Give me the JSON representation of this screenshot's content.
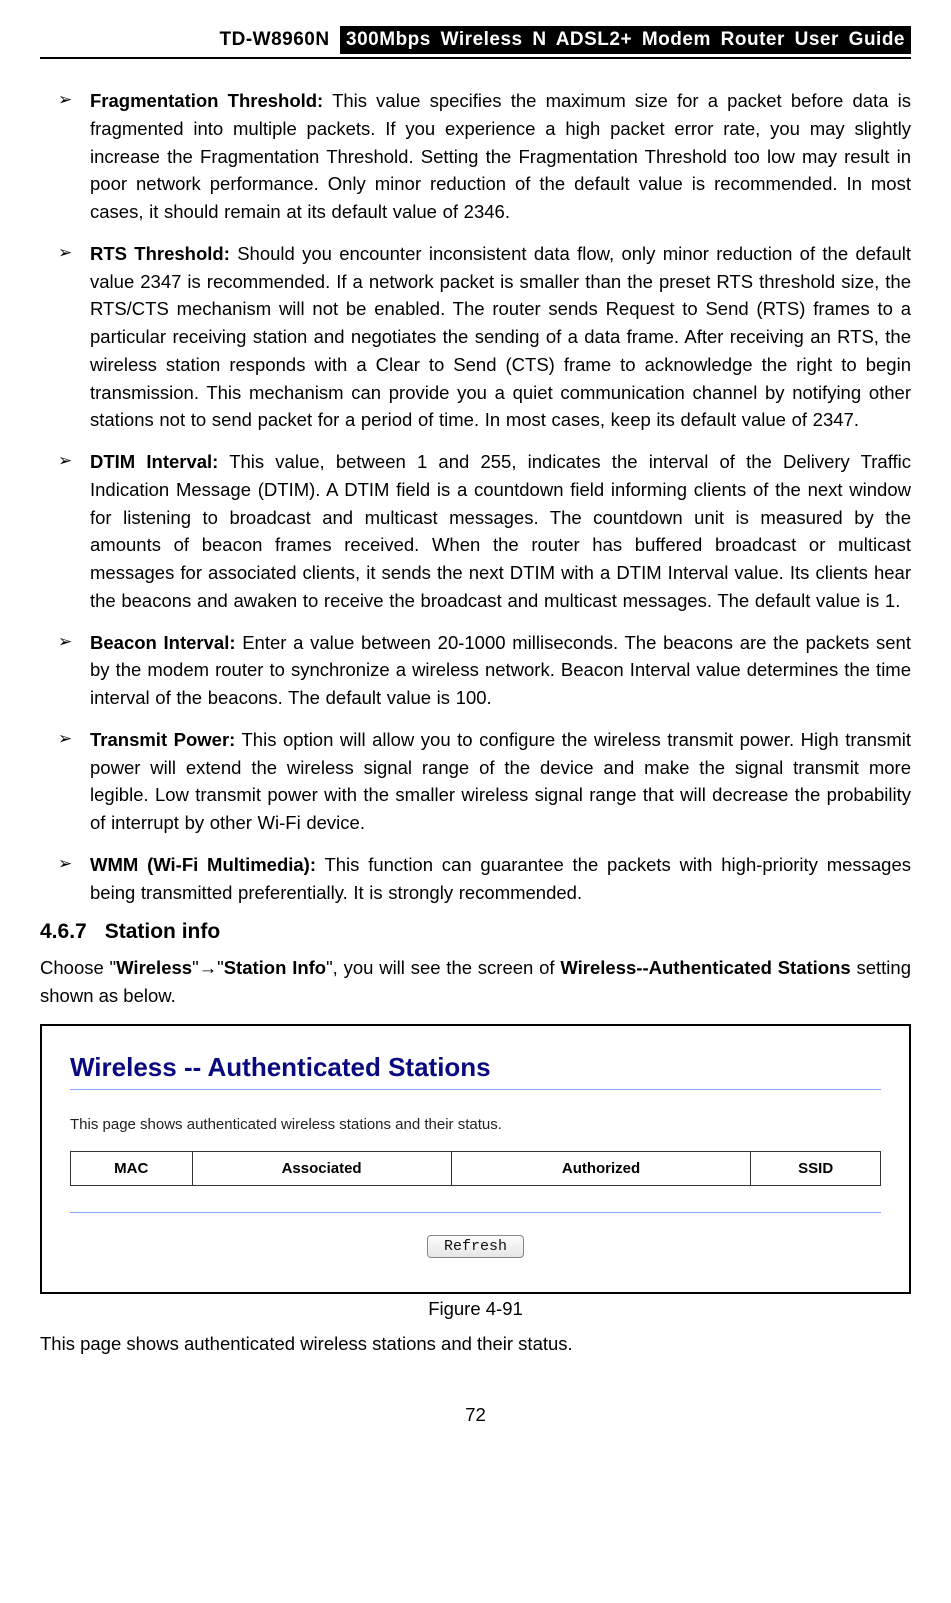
{
  "header": {
    "model": "TD-W8960N",
    "title": "300Mbps Wireless N ADSL2+ Modem Router User Guide"
  },
  "bullets": [
    {
      "term": "Fragmentation Threshold:",
      "text": " This value specifies the maximum size for a packet before data is fragmented into multiple packets. If you experience a high packet error rate, you may slightly increase the Fragmentation Threshold. Setting the Fragmentation Threshold too low may result in poor network performance. Only minor reduction of the default value is recommended. In most cases, it should remain at its default value of 2346."
    },
    {
      "term": "RTS Threshold:",
      "text": " Should you encounter inconsistent data flow, only minor reduction of the default value 2347 is recommended. If a network packet is smaller than the preset RTS threshold size, the RTS/CTS mechanism will not be enabled. The router sends Request to Send (RTS) frames to a particular receiving station and negotiates the sending of a data frame. After receiving an RTS, the wireless station responds with a Clear to Send (CTS) frame to acknowledge the right to begin transmission. This mechanism can provide you a quiet communication channel by notifying other stations not to send packet for a period of time. In most cases, keep its default value of 2347."
    },
    {
      "term": "DTIM Interval:",
      "text": " This value, between 1 and 255, indicates the interval of the Delivery Traffic Indication Message (DTIM). A DTIM field is a countdown field informing clients of the next window for listening to broadcast and multicast messages. The countdown unit is measured by the amounts of beacon frames received. When the router has buffered broadcast or multicast messages for associated clients, it sends the next DTIM with a DTIM Interval value. Its clients hear the beacons and awaken to receive the broadcast and multicast messages. The default value is 1."
    },
    {
      "term": "Beacon Interval:",
      "text": " Enter a value between 20-1000 milliseconds. The beacons are the packets sent by the modem router to synchronize a wireless network. Beacon Interval value determines the time interval of the beacons. The default value is 100."
    },
    {
      "term": "Transmit Power:",
      "text": " This option will allow you to configure the wireless transmit power. High transmit power will extend the wireless signal range of the device and make the signal transmit more legible. Low transmit power with the smaller wireless signal range that will decrease the probability of interrupt by other Wi-Fi device."
    },
    {
      "term": "WMM (Wi-Fi Multimedia):",
      "text": " This function can guarantee the packets with high-priority messages being transmitted preferentially. It is strongly recommended."
    }
  ],
  "section": {
    "number": "4.6.7",
    "title": "Station info"
  },
  "nav_para": {
    "pre": "Choose \"",
    "b1": "Wireless",
    "mid1": "\"",
    "arrow": "→",
    "mid2": "\"",
    "b2": "Station Info",
    "mid3": "\", you will see the screen of ",
    "b3": "Wireless--Authenticated Stations",
    "post": " setting shown as below."
  },
  "screenshot": {
    "title": "Wireless -- Authenticated Stations",
    "desc": "This page shows authenticated wireless stations and their status.",
    "columns": [
      "MAC",
      "Associated",
      "Authorized",
      "SSID"
    ],
    "button": "Refresh"
  },
  "figure_caption": "Figure 4-91",
  "closing_para": "This page shows authenticated wireless stations and their status.",
  "page_number": "72"
}
